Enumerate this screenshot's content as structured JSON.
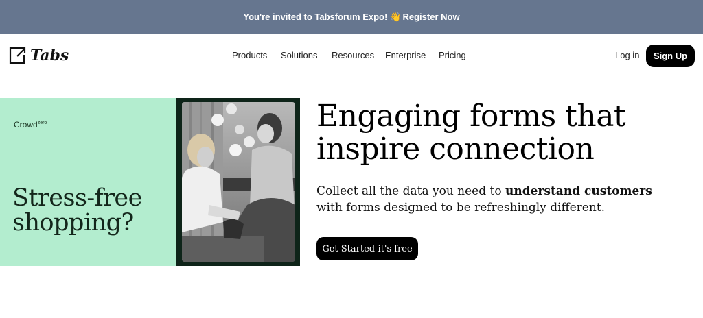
{
  "banner": {
    "text": "You're invited to Tabsforum Expo!",
    "emoji": "👋",
    "link_label": "Register Now"
  },
  "nav": {
    "logo_text": "Tabs",
    "logo_icon": "external-link-icon",
    "menu": [
      "Products",
      "Solutions",
      "Resources",
      "Enterprise",
      "Pricing"
    ],
    "login_label": "Log in",
    "signup_label": "Sign Up"
  },
  "hero": {
    "ad": {
      "brand": "Crowd",
      "brand_superscript": "zero",
      "tagline_line1": "Stress-free",
      "tagline_line2": "shopping?"
    },
    "headline_line1": "Engaging forms that",
    "headline_line2": "inspire connection",
    "subtext_prefix": "Collect all the data you need to ",
    "subtext_bold": "understand customers",
    "subtext_suffix": "with forms designed to be refreshingly different.",
    "cta_label": "Get Started-it's free"
  },
  "colors": {
    "banner_bg": "#66768f",
    "ad_bg": "#b3edcf",
    "photo_frame": "#0e2419",
    "button_bg": "#000000"
  }
}
